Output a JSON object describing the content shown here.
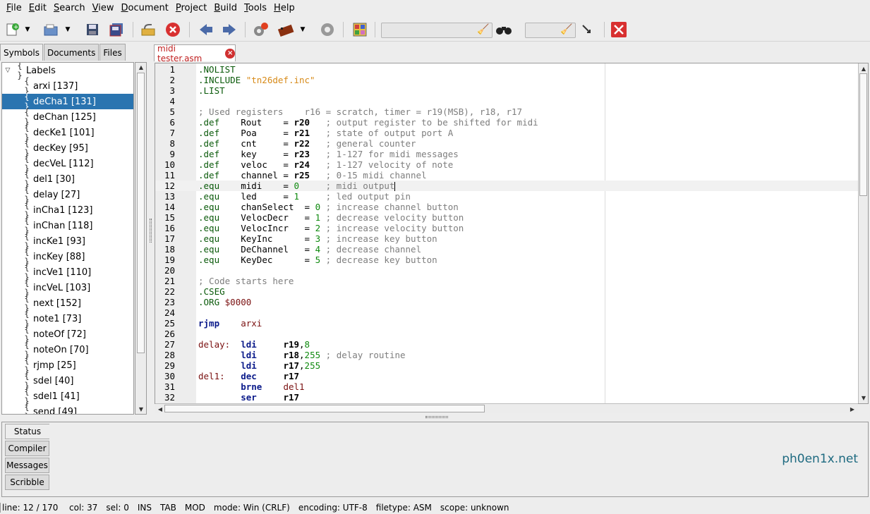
{
  "menu": [
    "File",
    "Edit",
    "Search",
    "View",
    "Document",
    "Project",
    "Build",
    "Tools",
    "Help"
  ],
  "menu_mnemonic": [
    "F",
    "E",
    "S",
    "V",
    "D",
    "P",
    "B",
    "T",
    "H"
  ],
  "toolbar_icons": [
    "new-file-icon",
    "open-file-icon",
    "save-icon",
    "save-all-icon",
    "revert-icon",
    "close-file-icon",
    "back-icon",
    "forward-icon",
    "compile-icon",
    "build-icon",
    "run-icon",
    "color-chooser-icon",
    "clear-icon",
    "find-icon",
    "clear-icon",
    "goto-line-icon",
    "quit-icon"
  ],
  "sidebar": {
    "tabs": [
      "Symbols",
      "Documents",
      "Files"
    ],
    "root": "Labels",
    "items": [
      "arxi [137]",
      "deCha1 [131]",
      "deChan [125]",
      "decKe1 [101]",
      "decKey [95]",
      "decVeL [112]",
      "del1 [30]",
      "delay [27]",
      "inCha1 [123]",
      "inChan [118]",
      "incKe1 [93]",
      "incKey [88]",
      "incVe1 [110]",
      "incVeL [103]",
      "next [152]",
      "note1 [73]",
      "noteOf [72]",
      "noteOn [70]",
      "rjmp [25]",
      "sdel [40]",
      "sdel1 [41]",
      "send [49]"
    ],
    "selected_index": 1
  },
  "document": {
    "tab": "midi tester.asm",
    "current_line": 12
  },
  "code": [
    {
      "n": "1",
      "t": [
        [
          ".NOLIST",
          "kw"
        ]
      ]
    },
    {
      "n": "2",
      "t": [
        [
          ".INCLUDE ",
          "kw"
        ],
        [
          "\"tn26def.inc\"",
          "str"
        ]
      ]
    },
    {
      "n": "3",
      "t": [
        [
          ".LIST",
          "kw"
        ]
      ]
    },
    {
      "n": "4",
      "t": []
    },
    {
      "n": "5",
      "t": [
        [
          "; Used registers    r16 = scratch, timer = r19(MSB), r18, r17",
          "cm"
        ]
      ]
    },
    {
      "n": "6",
      "t": [
        [
          ".def",
          "kw"
        ],
        [
          "    Rout    = ",
          ""
        ],
        [
          "r20",
          "reg"
        ],
        [
          "   ; output register to be shifted for midi",
          "cm"
        ]
      ]
    },
    {
      "n": "7",
      "t": [
        [
          ".def",
          "kw"
        ],
        [
          "    Poa     = ",
          ""
        ],
        [
          "r21",
          "reg"
        ],
        [
          "   ; state of output port A",
          "cm"
        ]
      ]
    },
    {
      "n": "8",
      "t": [
        [
          ".def",
          "kw"
        ],
        [
          "    cnt     = ",
          ""
        ],
        [
          "r22",
          "reg"
        ],
        [
          "   ; general counter",
          "cm"
        ]
      ]
    },
    {
      "n": "9",
      "t": [
        [
          ".def",
          "kw"
        ],
        [
          "    key     = ",
          ""
        ],
        [
          "r23",
          "reg"
        ],
        [
          "   ; 1-127 for midi messages",
          "cm"
        ]
      ]
    },
    {
      "n": "10",
      "t": [
        [
          ".def",
          "kw"
        ],
        [
          "    veloc   = ",
          ""
        ],
        [
          "r24",
          "reg"
        ],
        [
          "   ; 1-127 velocity of note",
          "cm"
        ]
      ]
    },
    {
      "n": "11",
      "t": [
        [
          ".def",
          "kw"
        ],
        [
          "    channel = ",
          ""
        ],
        [
          "r25",
          "reg"
        ],
        [
          "   ; 0-15 midi channel",
          "cm"
        ]
      ]
    },
    {
      "n": "12",
      "t": [
        [
          ".equ",
          "kw"
        ],
        [
          "    midi    = ",
          ""
        ],
        [
          "0",
          "num"
        ],
        [
          "     ; midi output",
          "cm"
        ]
      ]
    },
    {
      "n": "13",
      "t": [
        [
          ".equ",
          "kw"
        ],
        [
          "    led     = ",
          ""
        ],
        [
          "1",
          "num"
        ],
        [
          "     ; led output pin",
          "cm"
        ]
      ]
    },
    {
      "n": "14",
      "t": [
        [
          ".equ",
          "kw"
        ],
        [
          "    chanSelect  = ",
          ""
        ],
        [
          "0",
          "num"
        ],
        [
          " ; increase channel button",
          "cm"
        ]
      ]
    },
    {
      "n": "15",
      "t": [
        [
          ".equ",
          "kw"
        ],
        [
          "    VelocDecr   = ",
          ""
        ],
        [
          "1",
          "num"
        ],
        [
          " ; decrease velocity button",
          "cm"
        ]
      ]
    },
    {
      "n": "16",
      "t": [
        [
          ".equ",
          "kw"
        ],
        [
          "    VelocIncr   = ",
          ""
        ],
        [
          "2",
          "num"
        ],
        [
          " ; increase velocity button",
          "cm"
        ]
      ]
    },
    {
      "n": "17",
      "t": [
        [
          ".equ",
          "kw"
        ],
        [
          "    KeyInc      = ",
          ""
        ],
        [
          "3",
          "num"
        ],
        [
          " ; increase key button",
          "cm"
        ]
      ]
    },
    {
      "n": "18",
      "t": [
        [
          ".equ",
          "kw"
        ],
        [
          "    DeChannel   = ",
          ""
        ],
        [
          "4",
          "num"
        ],
        [
          " ; decrease channel",
          "cm"
        ]
      ]
    },
    {
      "n": "19",
      "t": [
        [
          ".equ",
          "kw"
        ],
        [
          "    KeyDec      = ",
          ""
        ],
        [
          "5",
          "num"
        ],
        [
          " ; decrease key button",
          "cm"
        ]
      ]
    },
    {
      "n": "20",
      "t": []
    },
    {
      "n": "21",
      "t": [
        [
          "; Code starts here",
          "cm"
        ]
      ]
    },
    {
      "n": "22",
      "t": [
        [
          ".CSEG",
          "kw"
        ]
      ]
    },
    {
      "n": "23",
      "t": [
        [
          ".ORG ",
          "kw"
        ],
        [
          "$0000",
          "lb"
        ]
      ]
    },
    {
      "n": "24",
      "t": []
    },
    {
      "n": "25",
      "t": [
        [
          "rjmp",
          "ins"
        ],
        [
          "    arxi",
          "lb"
        ]
      ]
    },
    {
      "n": "26",
      "t": []
    },
    {
      "n": "27",
      "t": [
        [
          "delay:",
          "lb"
        ],
        [
          "  ",
          ""
        ],
        [
          "ldi",
          "ins"
        ],
        [
          "     ",
          ""
        ],
        [
          "r19",
          "reg"
        ],
        [
          ",",
          ""
        ],
        [
          "8",
          "num"
        ]
      ]
    },
    {
      "n": "28",
      "t": [
        [
          "        ",
          ""
        ],
        [
          "ldi",
          "ins"
        ],
        [
          "     ",
          ""
        ],
        [
          "r18",
          "reg"
        ],
        [
          ",",
          ""
        ],
        [
          "255",
          "num"
        ],
        [
          " ; delay routine",
          "cm"
        ]
      ]
    },
    {
      "n": "29",
      "t": [
        [
          "        ",
          ""
        ],
        [
          "ldi",
          "ins"
        ],
        [
          "     ",
          ""
        ],
        [
          "r17",
          "reg"
        ],
        [
          ",",
          ""
        ],
        [
          "255",
          "num"
        ]
      ]
    },
    {
      "n": "30",
      "t": [
        [
          "del1:",
          "lb"
        ],
        [
          "   ",
          ""
        ],
        [
          "dec",
          "ins"
        ],
        [
          "     ",
          ""
        ],
        [
          "r17",
          "reg"
        ]
      ]
    },
    {
      "n": "31",
      "t": [
        [
          "        ",
          ""
        ],
        [
          "brne",
          "ins"
        ],
        [
          "    ",
          ""
        ],
        [
          "del1",
          "lb"
        ]
      ]
    },
    {
      "n": "32",
      "t": [
        [
          "        ",
          ""
        ],
        [
          "ser",
          "ins"
        ],
        [
          "     ",
          ""
        ],
        [
          "r17",
          "reg"
        ]
      ]
    }
  ],
  "bottom_tabs": [
    "Status",
    "Compiler",
    "Messages",
    "Scribble"
  ],
  "watermark": "ph0en1x.net",
  "status": [
    "line: 12 / 170",
    "col: 37",
    "sel: 0",
    "INS",
    "TAB",
    "MOD",
    "mode: Win (CRLF)",
    "encoding: UTF-8",
    "filetype: ASM",
    "scope: unknown"
  ]
}
